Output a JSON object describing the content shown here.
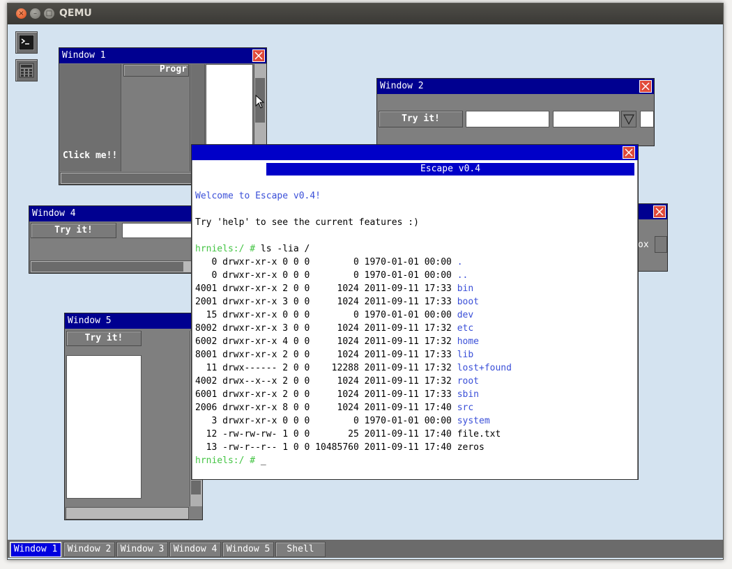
{
  "host": {
    "title": "QEMU"
  },
  "desktop": {
    "icons": [
      "terminal-icon",
      "calculator-icon"
    ]
  },
  "window1": {
    "title": "Window 1",
    "button_label": "Progr",
    "click_label": "Click me!!"
  },
  "window2": {
    "title": "Window 2",
    "button_label": "Try it!",
    "input_value": "",
    "select_value": ""
  },
  "window4": {
    "title": "Window 4",
    "button_label": "Try it!",
    "input_value": "",
    "clip_text": "ox"
  },
  "window5": {
    "title": "Window 5",
    "button_label": "Try it!"
  },
  "shell": {
    "banner": "Escape v0.4",
    "welcome": "Welcome to Escape v0.4!",
    "help": "Try 'help' to see the current features :)",
    "prompt": "hrniels:/ #",
    "command": " ls -lia /",
    "cursor": "_",
    "listing": [
      {
        "meta": "   0 drwxr-xr-x 0 0 0        0 1970-01-01 00:00 ",
        "name": ".",
        "dir": true
      },
      {
        "meta": "   0 drwxr-xr-x 0 0 0        0 1970-01-01 00:00 ",
        "name": "..",
        "dir": true
      },
      {
        "meta": "4001 drwxr-xr-x 2 0 0     1024 2011-09-11 17:33 ",
        "name": "bin",
        "dir": true
      },
      {
        "meta": "2001 drwxr-xr-x 3 0 0     1024 2011-09-11 17:33 ",
        "name": "boot",
        "dir": true
      },
      {
        "meta": "  15 drwxr-xr-x 0 0 0        0 1970-01-01 00:00 ",
        "name": "dev",
        "dir": true
      },
      {
        "meta": "8002 drwxr-xr-x 3 0 0     1024 2011-09-11 17:32 ",
        "name": "etc",
        "dir": true
      },
      {
        "meta": "6002 drwxr-xr-x 4 0 0     1024 2011-09-11 17:32 ",
        "name": "home",
        "dir": true
      },
      {
        "meta": "8001 drwxr-xr-x 2 0 0     1024 2011-09-11 17:33 ",
        "name": "lib",
        "dir": true
      },
      {
        "meta": "  11 drwx------ 2 0 0    12288 2011-09-11 17:32 ",
        "name": "lost+found",
        "dir": true
      },
      {
        "meta": "4002 drwx--x--x 2 0 0     1024 2011-09-11 17:32 ",
        "name": "root",
        "dir": true
      },
      {
        "meta": "6001 drwxr-xr-x 2 0 0     1024 2011-09-11 17:33 ",
        "name": "sbin",
        "dir": true
      },
      {
        "meta": "2006 drwxr-xr-x 8 0 0     1024 2011-09-11 17:40 ",
        "name": "src",
        "dir": true
      },
      {
        "meta": "   3 drwxr-xr-x 0 0 0        0 1970-01-01 00:00 ",
        "name": "system",
        "dir": true
      },
      {
        "meta": "  12 -rw-rw-rw- 1 0 0       25 2011-09-11 17:40 ",
        "name": "file.txt",
        "dir": false
      },
      {
        "meta": "  13 -rw-r--r-- 1 0 0 10485760 2011-09-11 17:40 ",
        "name": "zeros",
        "dir": false
      }
    ]
  },
  "taskbar": {
    "items": [
      "Window 1",
      "Window 2",
      "Window 3",
      "Window 4",
      "Window 5",
      "Shell"
    ],
    "active": "Window 1"
  },
  "colors": {
    "title_active": "#0000c8",
    "title_inactive": "#000090",
    "dir_blue": "#3a4fd8",
    "prompt_green": "#43c443"
  }
}
